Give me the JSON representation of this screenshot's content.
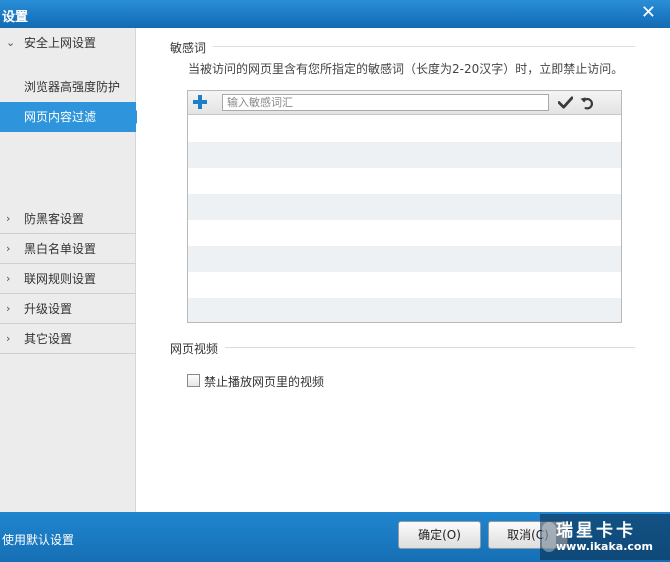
{
  "window": {
    "title": "设置",
    "close_glyph": "✕"
  },
  "sidebar": {
    "items": [
      {
        "label": "安全上网设置",
        "icon": "chevron-down-icon",
        "chevron": "⌄"
      },
      {
        "label": "浏览器高强度防护"
      },
      {
        "label": "网页内容过滤",
        "active": true
      },
      {
        "label": "防黑客设置",
        "icon": "chevron-right-icon",
        "chevron": "›"
      },
      {
        "label": "黑白名单设置",
        "icon": "chevron-right-icon",
        "chevron": "›"
      },
      {
        "label": "联网规则设置",
        "icon": "chevron-right-icon",
        "chevron": "›"
      },
      {
        "label": "升级设置",
        "icon": "chevron-right-icon",
        "chevron": "›"
      },
      {
        "label": "其它设置",
        "icon": "chevron-right-icon",
        "chevron": "›"
      }
    ]
  },
  "sensitive": {
    "title": "敏感词",
    "description": "当被访问的网页里含有您所指定的敏感词（长度为2-20汉字）时，立即禁止访问。",
    "input_placeholder": "输入敏感词汇",
    "input_value": "",
    "add_icon": "plus-icon",
    "confirm_icon": "checkmark-icon",
    "undo_icon": "undo-icon",
    "rows": [
      "",
      "",
      "",
      "",
      "",
      "",
      "",
      ""
    ]
  },
  "video": {
    "title": "网页视频",
    "checkbox_label": "禁止播放网页里的视频",
    "checked": false
  },
  "footer": {
    "reset_link": "使用默认设置",
    "ok_label": "确定(O)",
    "cancel_label": "取消(C)"
  },
  "watermark": {
    "title": "瑞星卡卡",
    "url": "www.ikaka.com"
  },
  "colors": {
    "accent": "#2e95dc",
    "titlebar": "#1a78c2",
    "footer": "#1a7cc3"
  }
}
